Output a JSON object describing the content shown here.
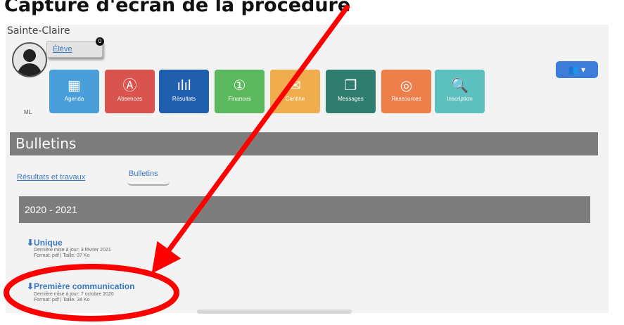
{
  "header": {
    "title": "Capture d'écran de la procédure"
  },
  "portal": {
    "school": "Sainte-Claire",
    "user_label": "Élève",
    "notification_count": "0",
    "group_button": "👥 ▾",
    "ml_label": "ML",
    "tiles": [
      {
        "label": "Agenda",
        "icon": "calendar-icon",
        "glyph": "▦",
        "color": "#4a9fdb"
      },
      {
        "label": "Absences",
        "icon": "absence-icon",
        "glyph": "Ⓐ",
        "color": "#d9544f"
      },
      {
        "label": "Résultats",
        "icon": "chart-icon",
        "glyph": "ılıl",
        "color": "#1f5fae"
      },
      {
        "label": "Finances",
        "icon": "finance-icon",
        "glyph": "①",
        "color": "#5cb85c"
      },
      {
        "label": "Cantine",
        "icon": "canteen-icon",
        "glyph": "✉",
        "color": "#f0ad4e"
      },
      {
        "label": "Messages",
        "icon": "messages-icon",
        "glyph": "❐",
        "color": "#2e7d6f"
      },
      {
        "label": "Ressources",
        "icon": "resources-icon",
        "glyph": "◎",
        "color": "#ee7e4a"
      },
      {
        "label": "Inscription",
        "icon": "inscription-icon",
        "glyph": "🔍",
        "color": "#5bc0be"
      }
    ],
    "section_title": "Bulletins",
    "tabs": {
      "results": "Résultats et travaux",
      "bulletins": "Bulletins"
    },
    "year": "2020 - 2021",
    "documents": [
      {
        "title": "⬇Unique",
        "line1": "Dernière mise à jour: 3 février 2021",
        "line2": "Format: pdf | Taille: 37 Ko"
      },
      {
        "title": "⬇Première communication",
        "line1": "Dernière mise à jour: 7 octobre 2020",
        "line2": "Format: pdf | Taille: 34 Ko"
      }
    ]
  },
  "annotation": {
    "arrow_color": "#ff0000",
    "ellipse_color": "#ff0000"
  }
}
